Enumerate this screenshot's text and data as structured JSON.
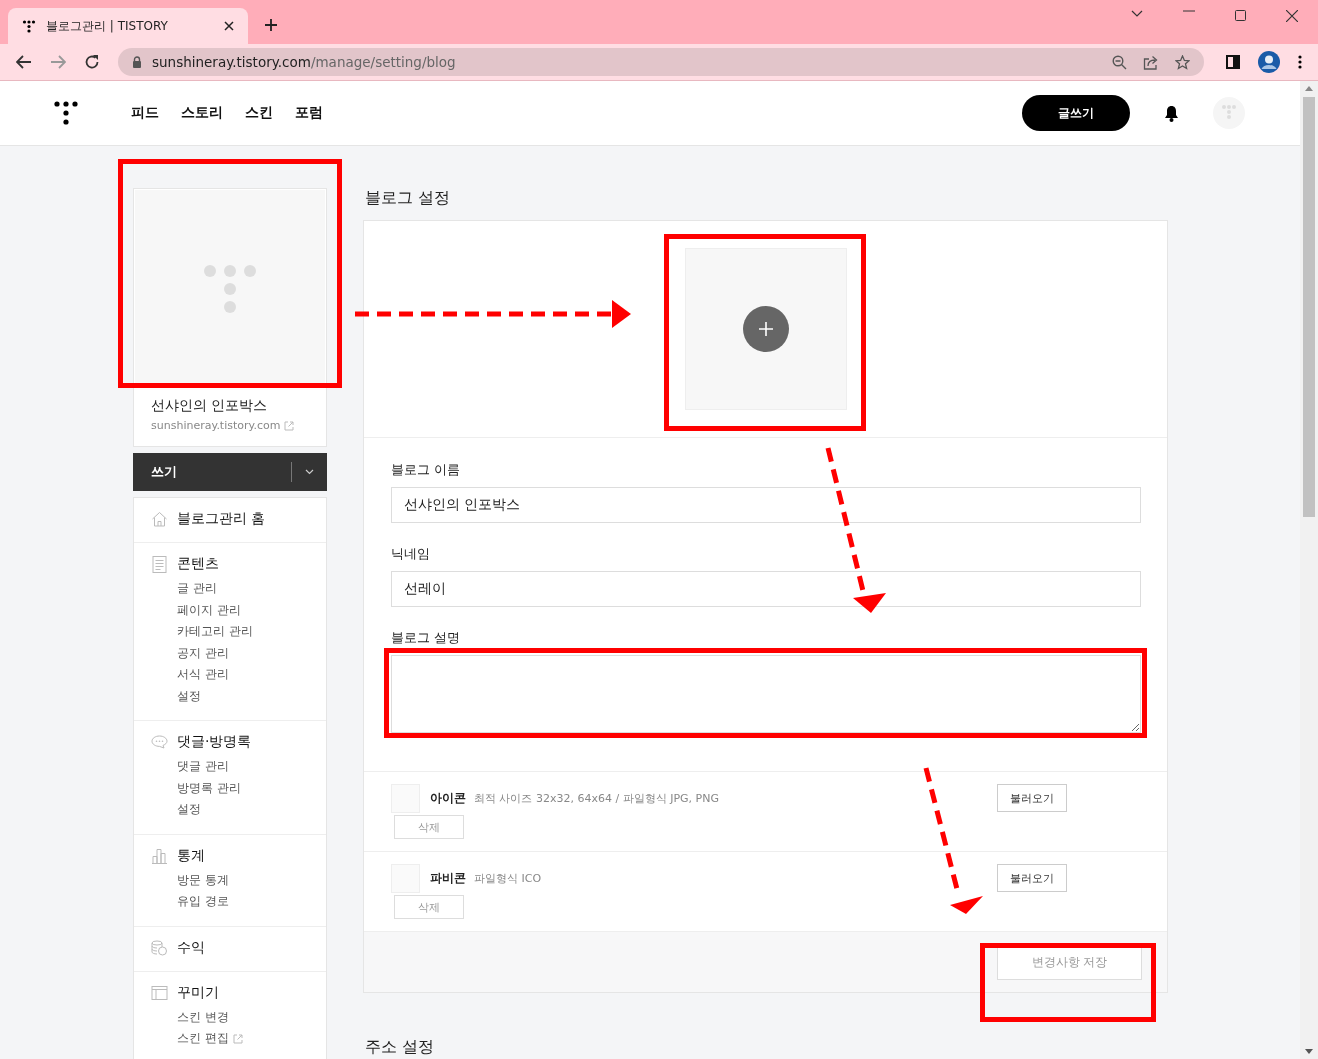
{
  "browser": {
    "tab_title": "블로그관리 | TISTORY",
    "url_host": "sunshineray.tistory.com",
    "url_path": "/manage/setting/blog"
  },
  "header": {
    "nav": [
      "피드",
      "스토리",
      "스킨",
      "포럼"
    ],
    "write_button": "글쓰기"
  },
  "sidebar": {
    "blog_name": "선샤인의 인포박스",
    "blog_url": "sunshineray.tistory.com",
    "write_button": "쓰기",
    "menu": [
      {
        "title": "블로그관리 홈",
        "kind": "home"
      },
      {
        "title": "콘텐츠",
        "kind": "document",
        "items": [
          {
            "label": "글 관리",
            "external": false
          },
          {
            "label": "페이지 관리",
            "external": false
          },
          {
            "label": "카테고리 관리",
            "external": false
          },
          {
            "label": "공지 관리",
            "external": false
          },
          {
            "label": "서식 관리",
            "external": false
          },
          {
            "label": "설정",
            "external": false
          }
        ]
      },
      {
        "title": "댓글·방명록",
        "kind": "chat",
        "items": [
          {
            "label": "댓글 관리",
            "external": false
          },
          {
            "label": "방명록 관리",
            "external": false
          },
          {
            "label": "설정",
            "external": false
          }
        ]
      },
      {
        "title": "통계",
        "kind": "chart",
        "items": [
          {
            "label": "방문 통계",
            "external": false
          },
          {
            "label": "유입 경로",
            "external": false
          }
        ]
      },
      {
        "title": "수익",
        "kind": "coins"
      },
      {
        "title": "꾸미기",
        "kind": "layout",
        "items": [
          {
            "label": "스킨 변경",
            "external": false
          },
          {
            "label": "스킨 편집",
            "external": true
          }
        ]
      }
    ]
  },
  "main": {
    "title": "블로그 설정",
    "fields": [
      {
        "kind": "input",
        "label": "블로그 이름",
        "value": "선샤인의 인포박스"
      },
      {
        "kind": "input",
        "label": "닉네임",
        "value": "선레이"
      },
      {
        "kind": "textarea",
        "label": "블로그 설명"
      }
    ],
    "uploads": [
      {
        "label": "아이콘",
        "hint": "최적 사이즈 32x32, 64x64 / 파일형식 JPG, PNG",
        "load_button": "불러오기",
        "delete_button": "삭제"
      },
      {
        "label": "파비콘",
        "hint": "파일형식 ICO",
        "load_button": "불러오기",
        "delete_button": "삭제"
      }
    ],
    "save_button": "변경사항 저장",
    "next_section": "주소 설정"
  }
}
